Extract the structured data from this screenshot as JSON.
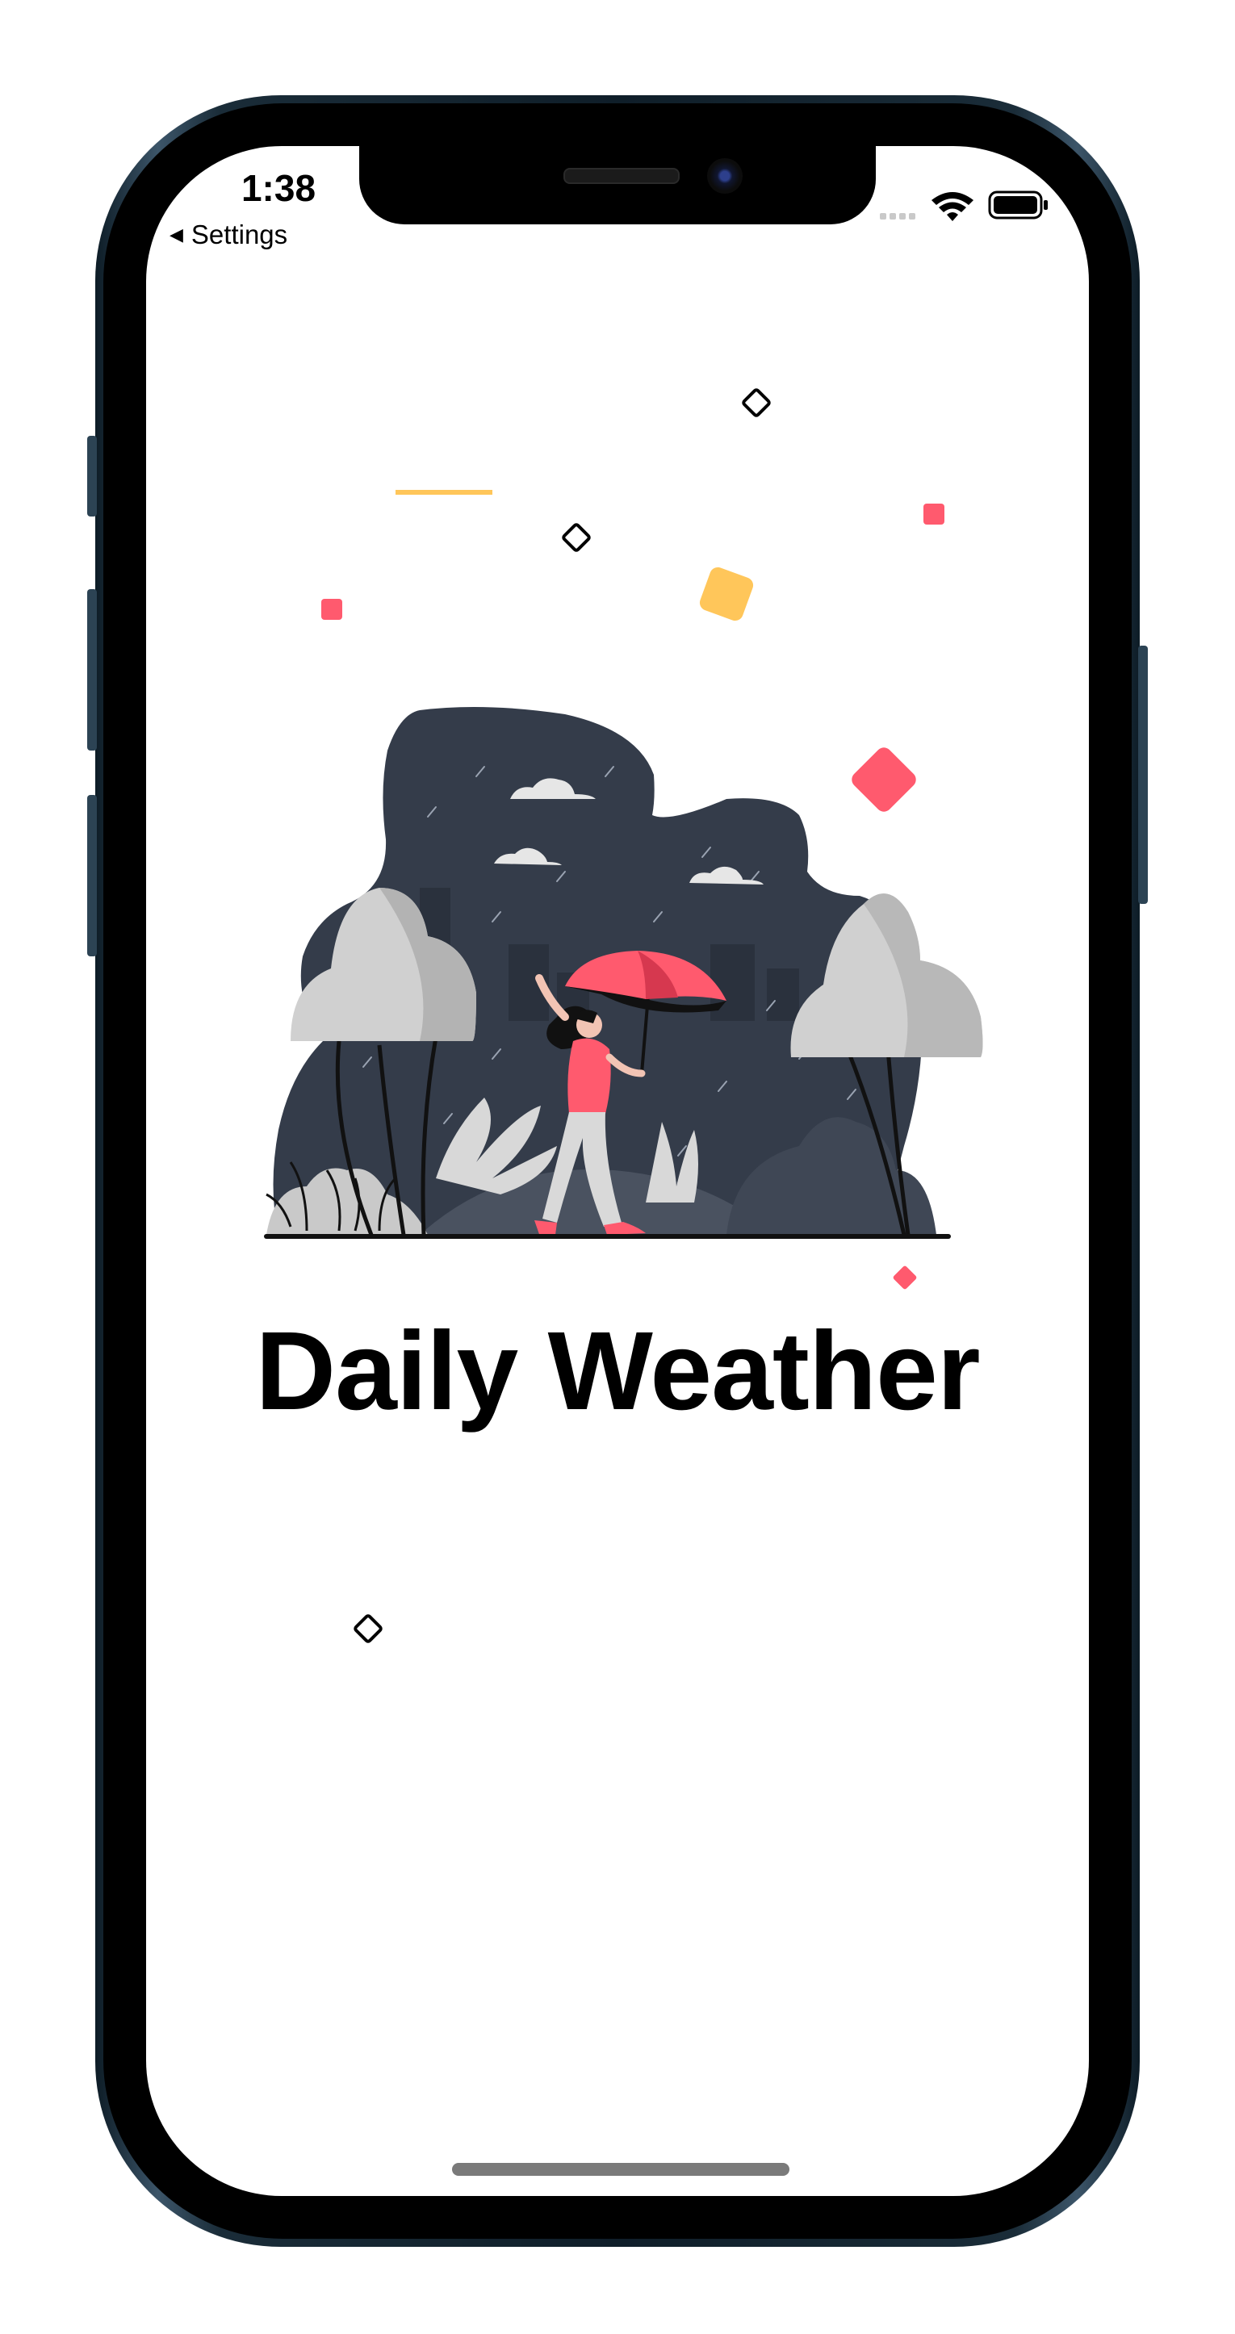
{
  "status_bar": {
    "time": "1:38",
    "back_label": "Settings"
  },
  "app": {
    "title": "Daily Weather"
  },
  "icons": {
    "back": "back-caret-icon",
    "cellular": "cellular-signal-icon",
    "wifi": "wifi-icon",
    "battery": "battery-icon"
  },
  "colors": {
    "accent_pink": "#ff5a6e",
    "accent_yellow": "#ffc65a",
    "sky_dark": "#2f3745",
    "cloud_gray": "#cfcfcf",
    "title": "#000000"
  }
}
